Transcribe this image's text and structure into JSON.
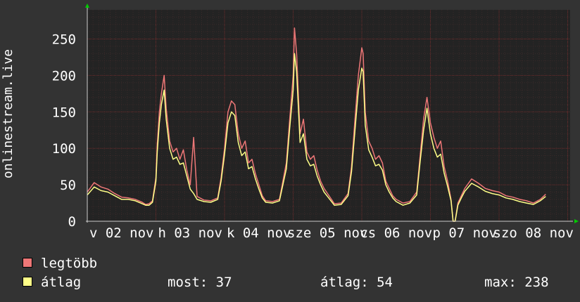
{
  "colors": {
    "background": "#333333",
    "plot_bg": "#232323",
    "grid": "#4a2a2a",
    "axis": "#cccccc",
    "max_series": "#ee7777",
    "avg_series": "#ffff88",
    "arrow": "#00cc00"
  },
  "chart_data": {
    "type": "line",
    "ylabel": "onlinestream.live",
    "ylim": [
      0,
      290
    ],
    "y_ticks": [
      "0",
      "50",
      "100",
      "150",
      "200",
      "250"
    ],
    "x_tick_labels": [
      "v 02 nov",
      "h 03 nov",
      "k 04 nov",
      "sze 05 nov",
      "cs 06 nov",
      "p 07 nov",
      "szo 08 nov"
    ],
    "series": [
      {
        "name": "legtöbb",
        "color": "#ee7777",
        "x": [
          0.0,
          0.1,
          0.2,
          0.3,
          0.4,
          0.5,
          0.6,
          0.7,
          0.8,
          0.85,
          0.9,
          0.95,
          1.0,
          1.02,
          1.05,
          1.08,
          1.12,
          1.15,
          1.2,
          1.25,
          1.3,
          1.35,
          1.4,
          1.45,
          1.5,
          1.55,
          1.6,
          1.7,
          1.8,
          1.9,
          1.95,
          2.0,
          2.05,
          2.1,
          2.15,
          2.2,
          2.25,
          2.3,
          2.35,
          2.4,
          2.45,
          2.5,
          2.55,
          2.6,
          2.7,
          2.8,
          2.9,
          2.95,
          3.0,
          3.02,
          3.05,
          3.1,
          3.15,
          3.2,
          3.25,
          3.3,
          3.35,
          3.4,
          3.45,
          3.5,
          3.6,
          3.7,
          3.8,
          3.85,
          3.9,
          3.95,
          4.0,
          4.02,
          4.05,
          4.1,
          4.15,
          4.2,
          4.25,
          4.3,
          4.35,
          4.4,
          4.45,
          4.5,
          4.6,
          4.7,
          4.8,
          4.85,
          4.9,
          4.95,
          5.0,
          5.05,
          5.1,
          5.15,
          5.2,
          5.25,
          5.3,
          5.33,
          5.36,
          5.4,
          5.45,
          5.5,
          5.6,
          5.7,
          5.8,
          5.9,
          6.0,
          6.1,
          6.2,
          6.3,
          6.4,
          6.5,
          6.6,
          6.68
        ],
        "values": [
          40,
          53,
          47,
          44,
          38,
          33,
          32,
          30,
          26,
          23,
          24,
          28,
          60,
          105,
          150,
          175,
          200,
          155,
          110,
          95,
          100,
          85,
          98,
          70,
          50,
          115,
          34,
          29,
          28,
          32,
          60,
          100,
          150,
          165,
          160,
          120,
          100,
          110,
          80,
          85,
          65,
          50,
          35,
          28,
          27,
          30,
          80,
          140,
          200,
          265,
          230,
          120,
          140,
          95,
          85,
          90,
          70,
          55,
          45,
          38,
          24,
          25,
          38,
          75,
          140,
          200,
          238,
          230,
          150,
          110,
          100,
          85,
          90,
          80,
          55,
          45,
          35,
          30,
          25,
          27,
          40,
          90,
          140,
          170,
          135,
          115,
          100,
          110,
          75,
          55,
          30,
          0,
          0,
          25,
          35,
          45,
          58,
          52,
          45,
          42,
          40,
          35,
          33,
          30,
          28,
          25,
          30,
          37
        ]
      },
      {
        "name": "átlag",
        "color": "#ffff88",
        "x": [
          0.0,
          0.1,
          0.2,
          0.3,
          0.4,
          0.5,
          0.6,
          0.7,
          0.8,
          0.85,
          0.9,
          0.95,
          1.0,
          1.02,
          1.05,
          1.08,
          1.12,
          1.15,
          1.2,
          1.25,
          1.3,
          1.35,
          1.4,
          1.45,
          1.5,
          1.55,
          1.6,
          1.7,
          1.8,
          1.9,
          1.95,
          2.0,
          2.05,
          2.1,
          2.15,
          2.2,
          2.25,
          2.3,
          2.35,
          2.4,
          2.45,
          2.5,
          2.55,
          2.6,
          2.7,
          2.8,
          2.9,
          2.95,
          3.0,
          3.02,
          3.05,
          3.1,
          3.15,
          3.2,
          3.25,
          3.3,
          3.35,
          3.4,
          3.45,
          3.5,
          3.6,
          3.7,
          3.8,
          3.85,
          3.9,
          3.95,
          4.0,
          4.02,
          4.05,
          4.1,
          4.15,
          4.2,
          4.25,
          4.3,
          4.35,
          4.4,
          4.45,
          4.5,
          4.6,
          4.7,
          4.8,
          4.85,
          4.9,
          4.95,
          5.0,
          5.05,
          5.1,
          5.15,
          5.2,
          5.25,
          5.3,
          5.33,
          5.36,
          5.4,
          5.45,
          5.5,
          5.6,
          5.7,
          5.8,
          5.9,
          6.0,
          6.1,
          6.2,
          6.3,
          6.4,
          6.5,
          6.6,
          6.68
        ],
        "values": [
          36,
          47,
          42,
          40,
          35,
          30,
          30,
          28,
          24,
          22,
          22,
          26,
          55,
          95,
          135,
          160,
          180,
          140,
          100,
          85,
          88,
          78,
          80,
          62,
          44,
          38,
          30,
          27,
          26,
          30,
          55,
          92,
          135,
          150,
          145,
          108,
          90,
          95,
          72,
          75,
          58,
          44,
          32,
          26,
          25,
          28,
          72,
          128,
          180,
          230,
          205,
          108,
          120,
          85,
          76,
          78,
          62,
          50,
          40,
          34,
          22,
          23,
          35,
          68,
          125,
          180,
          210,
          205,
          132,
          98,
          88,
          76,
          78,
          70,
          50,
          40,
          32,
          27,
          22,
          25,
          36,
          82,
          125,
          155,
          120,
          100,
          88,
          92,
          66,
          48,
          28,
          0,
          0,
          22,
          32,
          41,
          52,
          47,
          41,
          38,
          36,
          32,
          30,
          27,
          25,
          23,
          28,
          34
        ]
      }
    ]
  },
  "legend": {
    "max_label": "legtöbb",
    "avg_label": "átlag"
  },
  "stats": {
    "current": "most: 37",
    "average": "átlag: 54",
    "max": "max: 238"
  }
}
